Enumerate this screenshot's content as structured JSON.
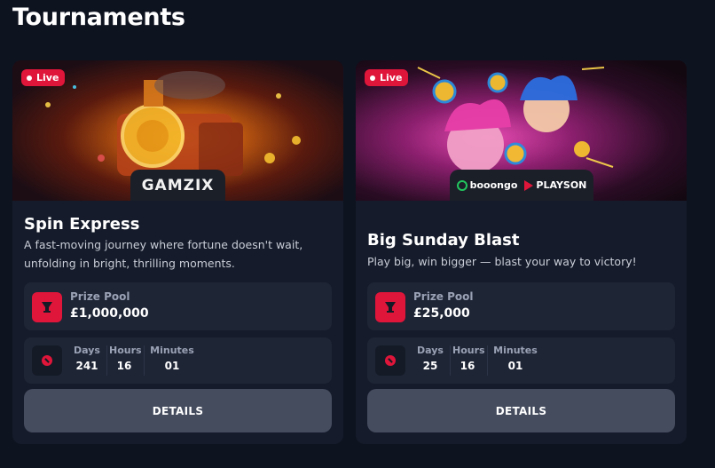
{
  "page": {
    "title": "Tournaments"
  },
  "colors": {
    "accent": "#e0153a",
    "background": "#0e1320",
    "card": "#151b2a",
    "button": "#454c5e"
  },
  "tournaments": [
    {
      "live_label": "Live",
      "provider": "GAMZIX",
      "title": "Spin Express",
      "description": "A fast-moving journey where fortune doesn't wait, unfolding in bright, thrilling moments.",
      "prize_label": "Prize Pool",
      "prize_value": "£1,000,000",
      "timer": {
        "days_label": "Days",
        "days": "241",
        "hours_label": "Hours",
        "hours": "16",
        "minutes_label": "Minutes",
        "minutes": "01"
      },
      "details_label": "DETAILS"
    },
    {
      "live_label": "Live",
      "provider_1": "booongo",
      "provider_2": "PLAYSON",
      "title": "Big Sunday Blast",
      "description": "Play big, win bigger — blast your way to victory!",
      "prize_label": "Prize Pool",
      "prize_value": "£25,000",
      "timer": {
        "days_label": "Days",
        "days": "25",
        "hours_label": "Hours",
        "hours": "16",
        "minutes_label": "Minutes",
        "minutes": "01"
      },
      "details_label": "DETAILS"
    }
  ]
}
